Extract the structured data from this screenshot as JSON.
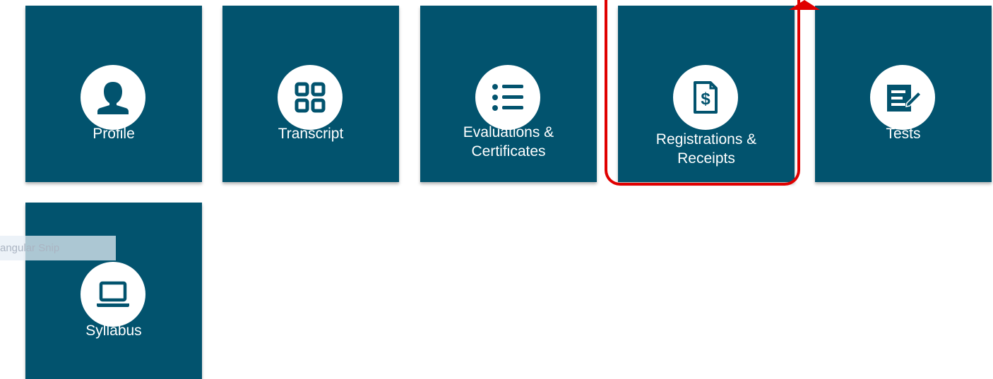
{
  "tiles": {
    "profile": {
      "label": "Profile",
      "icon": "user-icon"
    },
    "transcript": {
      "label": "Transcript",
      "icon": "grid-icon"
    },
    "evaluations": {
      "line1": "Evaluations &",
      "line2": "Certificates",
      "icon": "list-icon"
    },
    "registrations": {
      "line1": "Registrations &",
      "line2": "Receipts",
      "icon": "receipt-dollar-icon"
    },
    "tests": {
      "label": "Tests",
      "icon": "test-paper-icon"
    },
    "syllabus": {
      "label": "Syllabus",
      "icon": "laptop-icon"
    }
  },
  "snip_tooltip": {
    "text": "angular Snip"
  },
  "colors": {
    "tile_bg": "#02536e",
    "highlight": "#e00000",
    "icon_fg": "#02536e"
  }
}
